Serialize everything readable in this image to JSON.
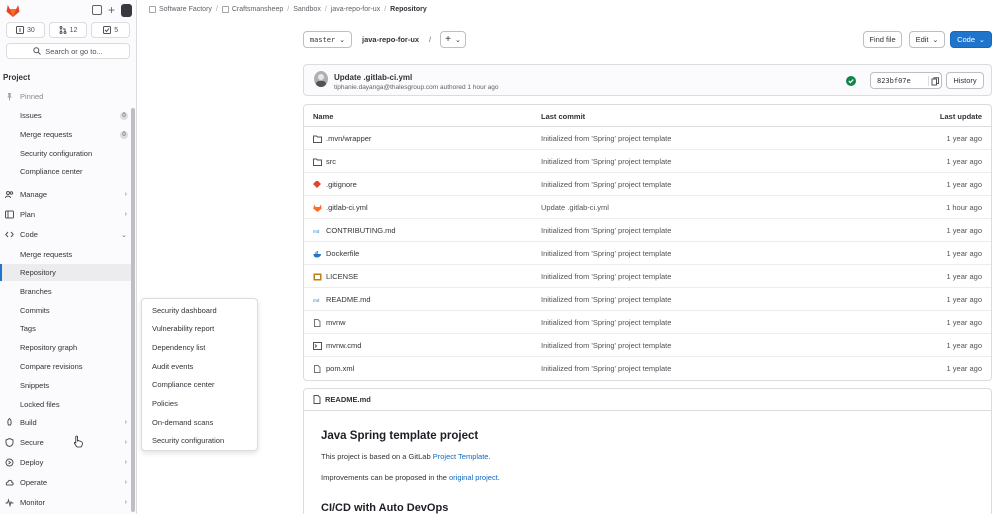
{
  "sidebar": {
    "counters": [
      {
        "value": "30"
      },
      {
        "value": "12"
      },
      {
        "value": "5"
      }
    ],
    "search_label": "Search or go to...",
    "section_title": "Project",
    "pinned_label": "Pinned",
    "pinned_items": [
      {
        "label": "Issues",
        "badge": "0"
      },
      {
        "label": "Merge requests",
        "badge": "0"
      },
      {
        "label": "Security configuration"
      },
      {
        "label": "Compliance center"
      }
    ],
    "groups": {
      "manage": "Manage",
      "plan": "Plan",
      "code": "Code",
      "build": "Build",
      "secure": "Secure",
      "deploy": "Deploy",
      "operate": "Operate",
      "monitor": "Monitor"
    },
    "code_items": [
      "Merge requests",
      "Repository",
      "Branches",
      "Commits",
      "Tags",
      "Repository graph",
      "Compare revisions",
      "Snippets",
      "Locked files"
    ]
  },
  "flyout": {
    "items": [
      "Security dashboard",
      "Vulnerability report",
      "Dependency list",
      "Audit events",
      "Compliance center",
      "Policies",
      "On-demand scans",
      "Security configuration"
    ]
  },
  "breadcrumb": {
    "items": [
      "Software Factory",
      "Craftsmansheep",
      "Sandbox",
      "java-repo-for-ux"
    ],
    "current": "Repository"
  },
  "toolbar": {
    "branch": "master",
    "repo": "java-repo-for-ux",
    "path_sep": "/",
    "add": "+",
    "find_file": "Find file",
    "edit": "Edit",
    "code": "Code"
  },
  "commit": {
    "title": "Update .gitlab-ci.yml",
    "meta": "tiphanie.dayanga@thalesgroup.com authored 1 hour ago",
    "sha": "823bf07e",
    "history": "History"
  },
  "table": {
    "headers": {
      "name": "Name",
      "commit": "Last commit",
      "update": "Last update"
    },
    "rows": [
      {
        "name": ".mvn/wrapper",
        "icon": "folder",
        "commit": "Initialized from 'Spring' project template",
        "update": "1 year ago"
      },
      {
        "name": "src",
        "icon": "folder",
        "commit": "Initialized from 'Spring' project template",
        "update": "1 year ago"
      },
      {
        "name": ".gitignore",
        "icon": "git",
        "commit": "Initialized from 'Spring' project template",
        "update": "1 year ago"
      },
      {
        "name": ".gitlab-ci.yml",
        "icon": "gitlab",
        "commit": "Update .gitlab-ci.yml",
        "update": "1 hour ago"
      },
      {
        "name": "CONTRIBUTING.md",
        "icon": "markdown",
        "commit": "Initialized from 'Spring' project template",
        "update": "1 year ago"
      },
      {
        "name": "Dockerfile",
        "icon": "docker",
        "commit": "Initialized from 'Spring' project template",
        "update": "1 year ago"
      },
      {
        "name": "LICENSE",
        "icon": "license",
        "commit": "Initialized from 'Spring' project template",
        "update": "1 year ago"
      },
      {
        "name": "README.md",
        "icon": "markdown",
        "commit": "Initialized from 'Spring' project template",
        "update": "1 year ago"
      },
      {
        "name": "mvnw",
        "icon": "file",
        "commit": "Initialized from 'Spring' project template",
        "update": "1 year ago"
      },
      {
        "name": "mvnw.cmd",
        "icon": "terminal",
        "commit": "Initialized from 'Spring' project template",
        "update": "1 year ago"
      },
      {
        "name": "pom.xml",
        "icon": "file",
        "commit": "Initialized from 'Spring' project template",
        "update": "1 year ago"
      }
    ]
  },
  "readme": {
    "filename": "README.md",
    "title": "Java Spring template project",
    "p1_prefix": "This project is based on a GitLab ",
    "p1_link": "Project Template",
    "p1_suffix": ".",
    "p2_prefix": "Improvements can be proposed in the ",
    "p2_link": "original project",
    "p2_suffix": ".",
    "h2": "CI/CD with Auto DevOps"
  }
}
